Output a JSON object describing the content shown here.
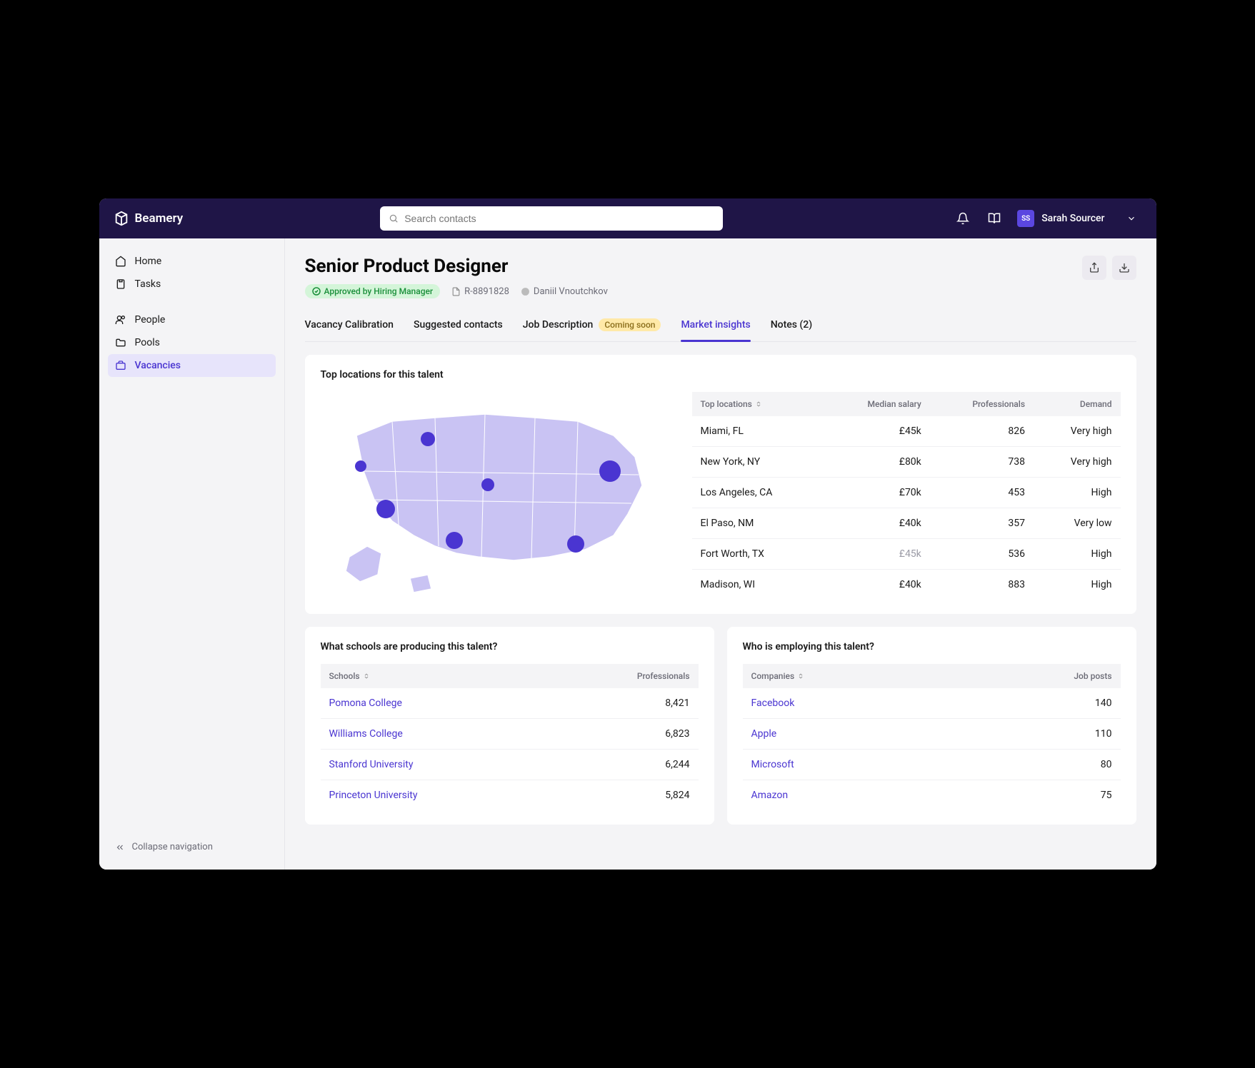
{
  "brand": "Beamery",
  "search": {
    "placeholder": "Search contacts"
  },
  "user": {
    "initials": "SS",
    "name": "Sarah Sourcer"
  },
  "sidebar": {
    "items": [
      {
        "label": "Home"
      },
      {
        "label": "Tasks"
      },
      {
        "label": "People"
      },
      {
        "label": "Pools"
      },
      {
        "label": "Vacancies"
      }
    ],
    "collapse": "Collapse navigation"
  },
  "page": {
    "title": "Senior Product Designer",
    "approval": "Approved by Hiring Manager",
    "req_id": "R-8891828",
    "owner": "Daniil Vnoutchkov"
  },
  "tabs": [
    {
      "label": "Vacancy Calibration"
    },
    {
      "label": "Suggested contacts"
    },
    {
      "label": "Job Description",
      "pill": "Coming soon"
    },
    {
      "label": "Market insights"
    },
    {
      "label": "Notes (2)"
    }
  ],
  "locations_card": {
    "title": "Top locations for this talent",
    "headers": {
      "loc": "Top locations",
      "salary": "Median salary",
      "pros": "Professionals",
      "demand": "Demand"
    },
    "rows": [
      {
        "loc": "Miami, FL",
        "salary": "£45k",
        "pros": "826",
        "demand": "Very high"
      },
      {
        "loc": "New York, NY",
        "salary": "£80k",
        "pros": "738",
        "demand": "Very high"
      },
      {
        "loc": "Los Angeles, CA",
        "salary": "£70k",
        "pros": "453",
        "demand": "High"
      },
      {
        "loc": "El Paso, NM",
        "salary": "£40k",
        "pros": "357",
        "demand": "Very low"
      },
      {
        "loc": "Fort Worth, TX",
        "salary": "£45k",
        "pros": "536",
        "demand": "High",
        "muted_salary": true
      },
      {
        "loc": "Madison, WI",
        "salary": "£40k",
        "pros": "883",
        "demand": "High"
      }
    ]
  },
  "schools_card": {
    "title": "What schools are producing this talent?",
    "headers": {
      "name": "Schools",
      "pros": "Professionals"
    },
    "rows": [
      {
        "name": "Pomona College",
        "pros": "8,421"
      },
      {
        "name": "Williams College",
        "pros": "6,823"
      },
      {
        "name": "Stanford University",
        "pros": "6,244"
      },
      {
        "name": "Princeton University",
        "pros": "5,824"
      }
    ]
  },
  "companies_card": {
    "title": "Who is employing this talent?",
    "headers": {
      "name": "Companies",
      "posts": "Job posts"
    },
    "rows": [
      {
        "name": "Facebook",
        "posts": "140"
      },
      {
        "name": "Apple",
        "posts": "110"
      },
      {
        "name": "Microsoft",
        "posts": "80"
      },
      {
        "name": "Amazon",
        "posts": "75"
      }
    ]
  }
}
